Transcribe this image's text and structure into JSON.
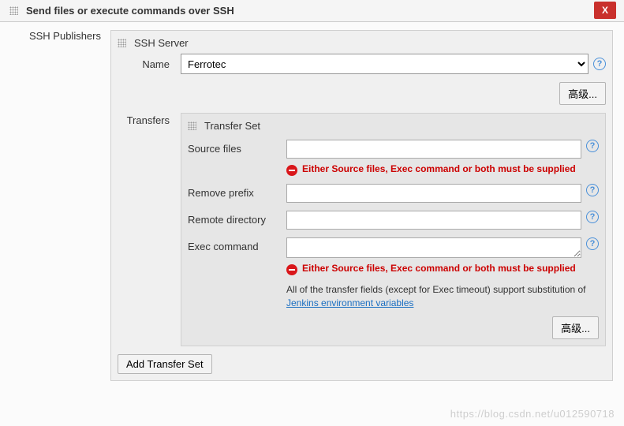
{
  "header": {
    "title": "Send files or execute commands over SSH",
    "close_label": "X"
  },
  "sidebar_label": "SSH Publishers",
  "ssh_server_section": "SSH Server",
  "name_label": "Name",
  "name_value": "Ferrotec",
  "advanced_btn": "高级...",
  "transfers_label": "Transfers",
  "transfer_set_title": "Transfer Set",
  "fields": {
    "source_files_label": "Source files",
    "source_files_value": "",
    "remove_prefix_label": "Remove prefix",
    "remove_prefix_value": "",
    "remote_directory_label": "Remote directory",
    "remote_directory_value": "",
    "exec_command_label": "Exec command",
    "exec_command_value": ""
  },
  "error_msg": "Either Source files, Exec command or both must be supplied",
  "help_note_a": "All of the transfer fields (except for Exec timeout) support substitution of ",
  "help_note_link": "Jenkins environment variables",
  "add_transfer_set": "Add Transfer Set",
  "watermark": "https://blog.csdn.net/u012590718"
}
